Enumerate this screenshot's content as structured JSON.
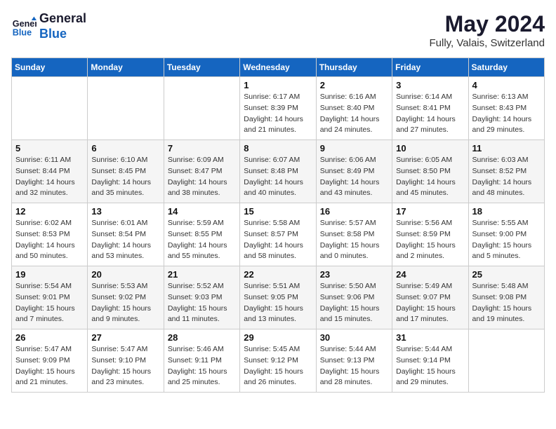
{
  "header": {
    "logo_line1": "General",
    "logo_line2": "Blue",
    "month_title": "May 2024",
    "location": "Fully, Valais, Switzerland"
  },
  "weekdays": [
    "Sunday",
    "Monday",
    "Tuesday",
    "Wednesday",
    "Thursday",
    "Friday",
    "Saturday"
  ],
  "weeks": [
    [
      {
        "day": "",
        "info": ""
      },
      {
        "day": "",
        "info": ""
      },
      {
        "day": "",
        "info": ""
      },
      {
        "day": "1",
        "info": "Sunrise: 6:17 AM\nSunset: 8:39 PM\nDaylight: 14 hours\nand 21 minutes."
      },
      {
        "day": "2",
        "info": "Sunrise: 6:16 AM\nSunset: 8:40 PM\nDaylight: 14 hours\nand 24 minutes."
      },
      {
        "day": "3",
        "info": "Sunrise: 6:14 AM\nSunset: 8:41 PM\nDaylight: 14 hours\nand 27 minutes."
      },
      {
        "day": "4",
        "info": "Sunrise: 6:13 AM\nSunset: 8:43 PM\nDaylight: 14 hours\nand 29 minutes."
      }
    ],
    [
      {
        "day": "5",
        "info": "Sunrise: 6:11 AM\nSunset: 8:44 PM\nDaylight: 14 hours\nand 32 minutes."
      },
      {
        "day": "6",
        "info": "Sunrise: 6:10 AM\nSunset: 8:45 PM\nDaylight: 14 hours\nand 35 minutes."
      },
      {
        "day": "7",
        "info": "Sunrise: 6:09 AM\nSunset: 8:47 PM\nDaylight: 14 hours\nand 38 minutes."
      },
      {
        "day": "8",
        "info": "Sunrise: 6:07 AM\nSunset: 8:48 PM\nDaylight: 14 hours\nand 40 minutes."
      },
      {
        "day": "9",
        "info": "Sunrise: 6:06 AM\nSunset: 8:49 PM\nDaylight: 14 hours\nand 43 minutes."
      },
      {
        "day": "10",
        "info": "Sunrise: 6:05 AM\nSunset: 8:50 PM\nDaylight: 14 hours\nand 45 minutes."
      },
      {
        "day": "11",
        "info": "Sunrise: 6:03 AM\nSunset: 8:52 PM\nDaylight: 14 hours\nand 48 minutes."
      }
    ],
    [
      {
        "day": "12",
        "info": "Sunrise: 6:02 AM\nSunset: 8:53 PM\nDaylight: 14 hours\nand 50 minutes."
      },
      {
        "day": "13",
        "info": "Sunrise: 6:01 AM\nSunset: 8:54 PM\nDaylight: 14 hours\nand 53 minutes."
      },
      {
        "day": "14",
        "info": "Sunrise: 5:59 AM\nSunset: 8:55 PM\nDaylight: 14 hours\nand 55 minutes."
      },
      {
        "day": "15",
        "info": "Sunrise: 5:58 AM\nSunset: 8:57 PM\nDaylight: 14 hours\nand 58 minutes."
      },
      {
        "day": "16",
        "info": "Sunrise: 5:57 AM\nSunset: 8:58 PM\nDaylight: 15 hours\nand 0 minutes."
      },
      {
        "day": "17",
        "info": "Sunrise: 5:56 AM\nSunset: 8:59 PM\nDaylight: 15 hours\nand 2 minutes."
      },
      {
        "day": "18",
        "info": "Sunrise: 5:55 AM\nSunset: 9:00 PM\nDaylight: 15 hours\nand 5 minutes."
      }
    ],
    [
      {
        "day": "19",
        "info": "Sunrise: 5:54 AM\nSunset: 9:01 PM\nDaylight: 15 hours\nand 7 minutes."
      },
      {
        "day": "20",
        "info": "Sunrise: 5:53 AM\nSunset: 9:02 PM\nDaylight: 15 hours\nand 9 minutes."
      },
      {
        "day": "21",
        "info": "Sunrise: 5:52 AM\nSunset: 9:03 PM\nDaylight: 15 hours\nand 11 minutes."
      },
      {
        "day": "22",
        "info": "Sunrise: 5:51 AM\nSunset: 9:05 PM\nDaylight: 15 hours\nand 13 minutes."
      },
      {
        "day": "23",
        "info": "Sunrise: 5:50 AM\nSunset: 9:06 PM\nDaylight: 15 hours\nand 15 minutes."
      },
      {
        "day": "24",
        "info": "Sunrise: 5:49 AM\nSunset: 9:07 PM\nDaylight: 15 hours\nand 17 minutes."
      },
      {
        "day": "25",
        "info": "Sunrise: 5:48 AM\nSunset: 9:08 PM\nDaylight: 15 hours\nand 19 minutes."
      }
    ],
    [
      {
        "day": "26",
        "info": "Sunrise: 5:47 AM\nSunset: 9:09 PM\nDaylight: 15 hours\nand 21 minutes."
      },
      {
        "day": "27",
        "info": "Sunrise: 5:47 AM\nSunset: 9:10 PM\nDaylight: 15 hours\nand 23 minutes."
      },
      {
        "day": "28",
        "info": "Sunrise: 5:46 AM\nSunset: 9:11 PM\nDaylight: 15 hours\nand 25 minutes."
      },
      {
        "day": "29",
        "info": "Sunrise: 5:45 AM\nSunset: 9:12 PM\nDaylight: 15 hours\nand 26 minutes."
      },
      {
        "day": "30",
        "info": "Sunrise: 5:44 AM\nSunset: 9:13 PM\nDaylight: 15 hours\nand 28 minutes."
      },
      {
        "day": "31",
        "info": "Sunrise: 5:44 AM\nSunset: 9:14 PM\nDaylight: 15 hours\nand 29 minutes."
      },
      {
        "day": "",
        "info": ""
      }
    ]
  ]
}
